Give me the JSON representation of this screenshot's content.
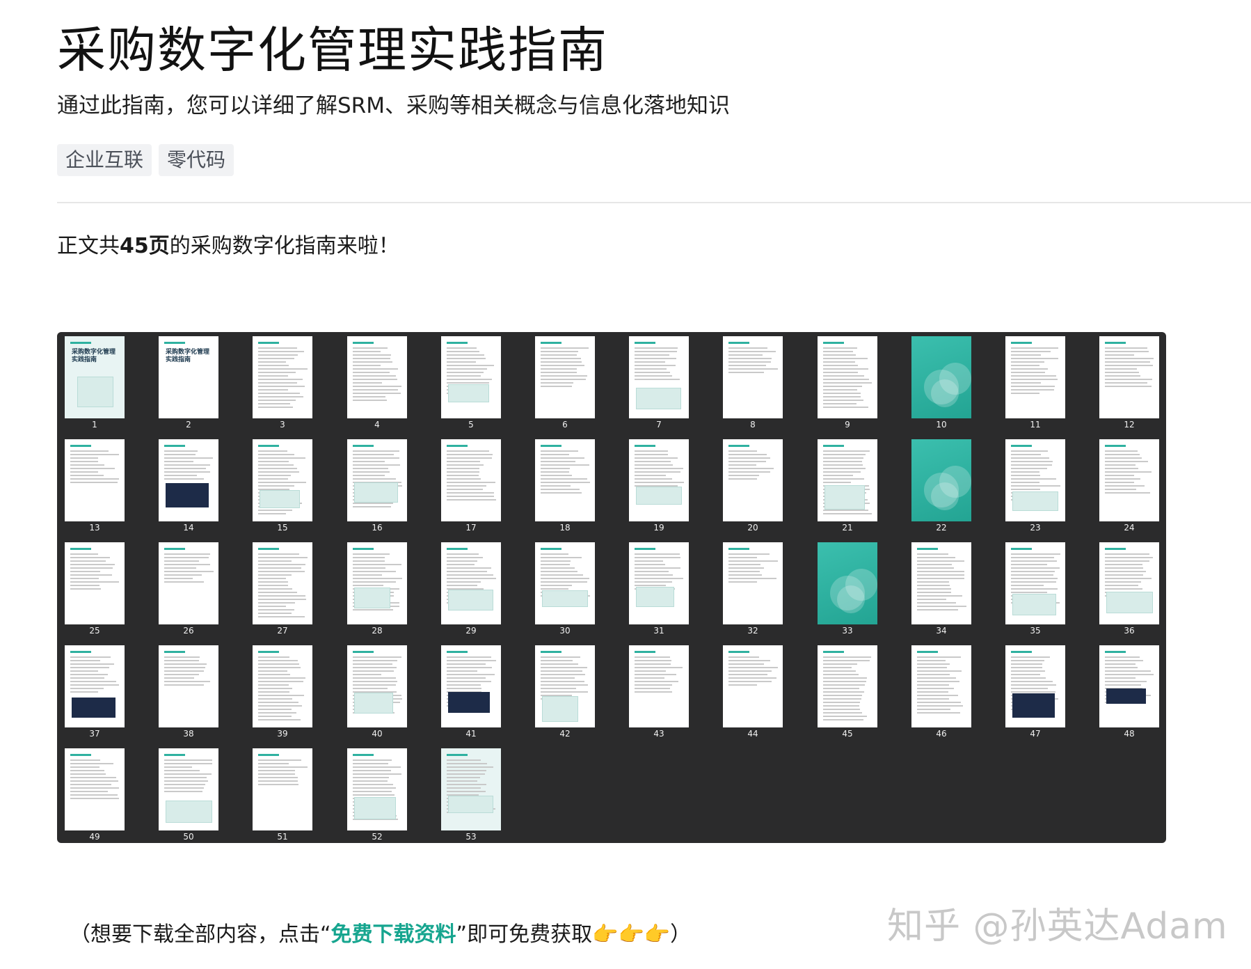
{
  "header": {
    "title": "采购数字化管理实践指南",
    "subtitle": "通过此指南，您可以详细了解SRM、采购等相关概念与信息化落地知识",
    "tags": [
      "企业互联",
      "零代码"
    ]
  },
  "intro": {
    "prefix": "正文共",
    "bold": "45页",
    "suffix": "的采购数字化指南来啦！"
  },
  "thumbnails": {
    "pages": [
      "1",
      "2",
      "3",
      "4",
      "5",
      "6",
      "7",
      "8",
      "9",
      "10",
      "11",
      "12",
      "13",
      "14",
      "15",
      "16",
      "17",
      "18",
      "19",
      "20",
      "21",
      "22",
      "23",
      "24",
      "25",
      "26",
      "27",
      "28",
      "29",
      "30",
      "31",
      "32",
      "33",
      "34",
      "35",
      "36",
      "37",
      "38",
      "39",
      "40",
      "41",
      "42",
      "43",
      "44",
      "45",
      "46",
      "47",
      "48",
      "49",
      "50",
      "51",
      "52",
      "53"
    ],
    "cover_text": "采购数字化管理\n实践指南",
    "teal_pages": [
      "10",
      "22",
      "33"
    ],
    "tinted_pages": [
      "1",
      "53"
    ],
    "accent_color": "#2fb1a0",
    "panel_color": "#2b2b2c"
  },
  "footer": {
    "prefix": "（想要下载全部内容，点击“",
    "link": "免费下载资料",
    "suffix": "”即可免费获取👉👉👉）"
  },
  "watermark": "知乎 @孙英达Adam"
}
